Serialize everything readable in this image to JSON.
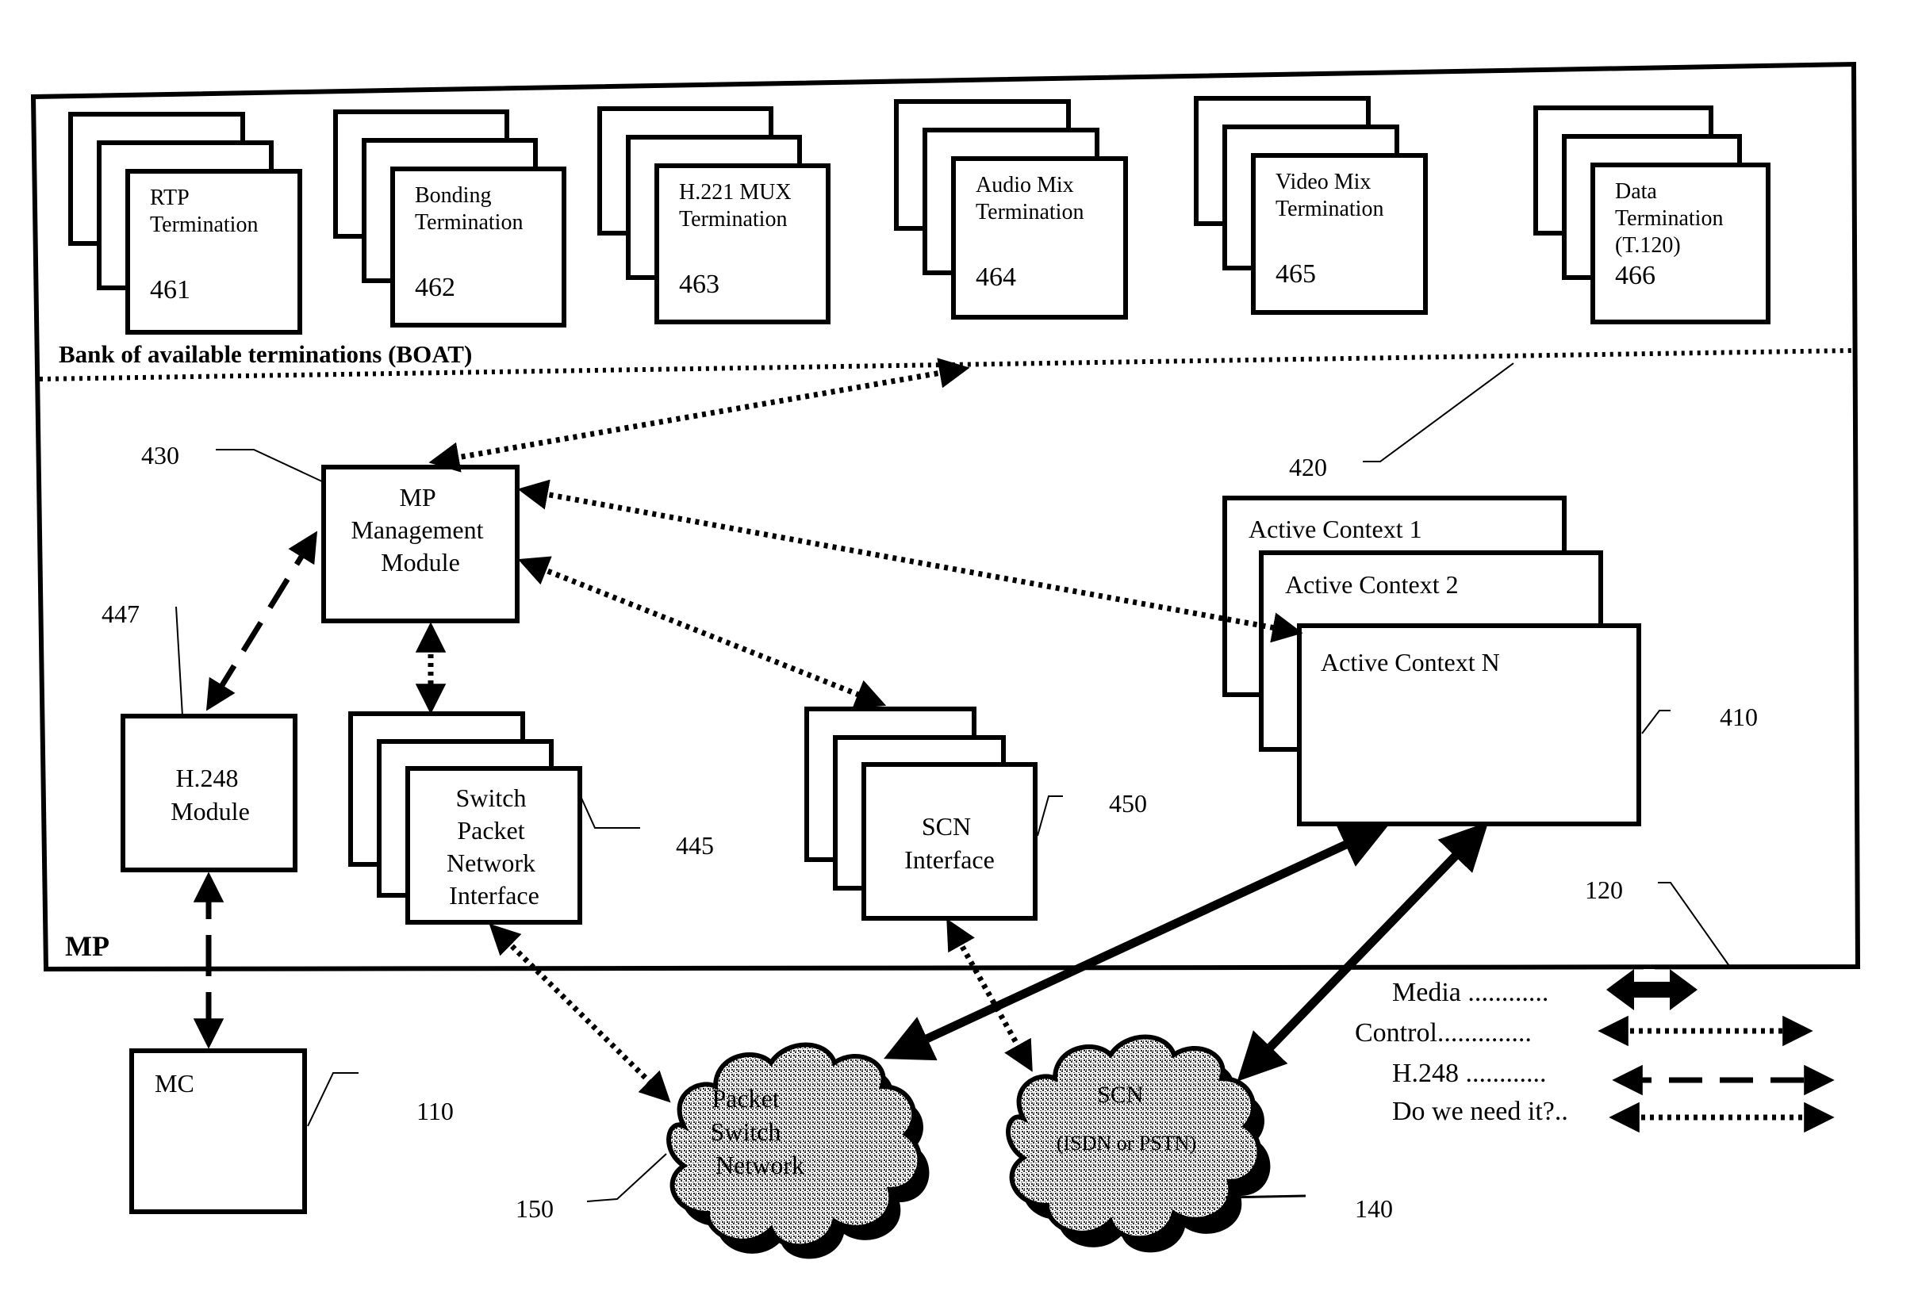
{
  "figure": {
    "mp_label": "MP",
    "boat_label": "Bank of available terminations (BOAT)",
    "terminations": [
      {
        "lines": [
          "RTP",
          "Termination"
        ],
        "ref": "461"
      },
      {
        "lines": [
          "Bonding",
          "Termination"
        ],
        "ref": "462"
      },
      {
        "lines": [
          "H.221 MUX",
          "Termination"
        ],
        "ref": "463"
      },
      {
        "lines": [
          "Audio Mix",
          "Termination"
        ],
        "ref": "464"
      },
      {
        "lines": [
          "Video Mix",
          "Termination"
        ],
        "ref": "465"
      },
      {
        "lines": [
          "Data",
          "Termination",
          "(T.120)"
        ],
        "ref": "466"
      }
    ],
    "mp_management": {
      "lines": [
        "MP",
        "Management",
        "Module"
      ],
      "ref": "430"
    },
    "h248_module": {
      "lines": [
        "H.248",
        "Module"
      ],
      "ref": "447"
    },
    "switch_packet": {
      "lines": [
        "Switch",
        "Packet",
        "Network",
        "Interface"
      ],
      "ref": "445"
    },
    "scn_interface": {
      "lines": [
        "SCN",
        "Interface"
      ],
      "ref": "450"
    },
    "active_contexts": {
      "items": [
        "Active Context 1",
        "Active Context 2",
        "Active Context N"
      ],
      "ref": "410"
    },
    "boat_ref": "420",
    "mp_ref": "120",
    "mc": {
      "label": "MC",
      "ref": "110"
    },
    "packet_cloud": {
      "lines": [
        "Packet",
        "Switch",
        "Network"
      ],
      "ref": "150"
    },
    "scn_cloud": {
      "lines": [
        "SCN",
        "(ISDN or PSTN)"
      ],
      "ref": "140"
    }
  },
  "legend": {
    "items": [
      {
        "label": "Media ............",
        "style": "solid-thick"
      },
      {
        "label": "Control..............",
        "style": "dotted"
      },
      {
        "label": "H.248 ............",
        "style": "dashed"
      },
      {
        "label": "Do we need it?..",
        "style": "dotted"
      }
    ]
  }
}
